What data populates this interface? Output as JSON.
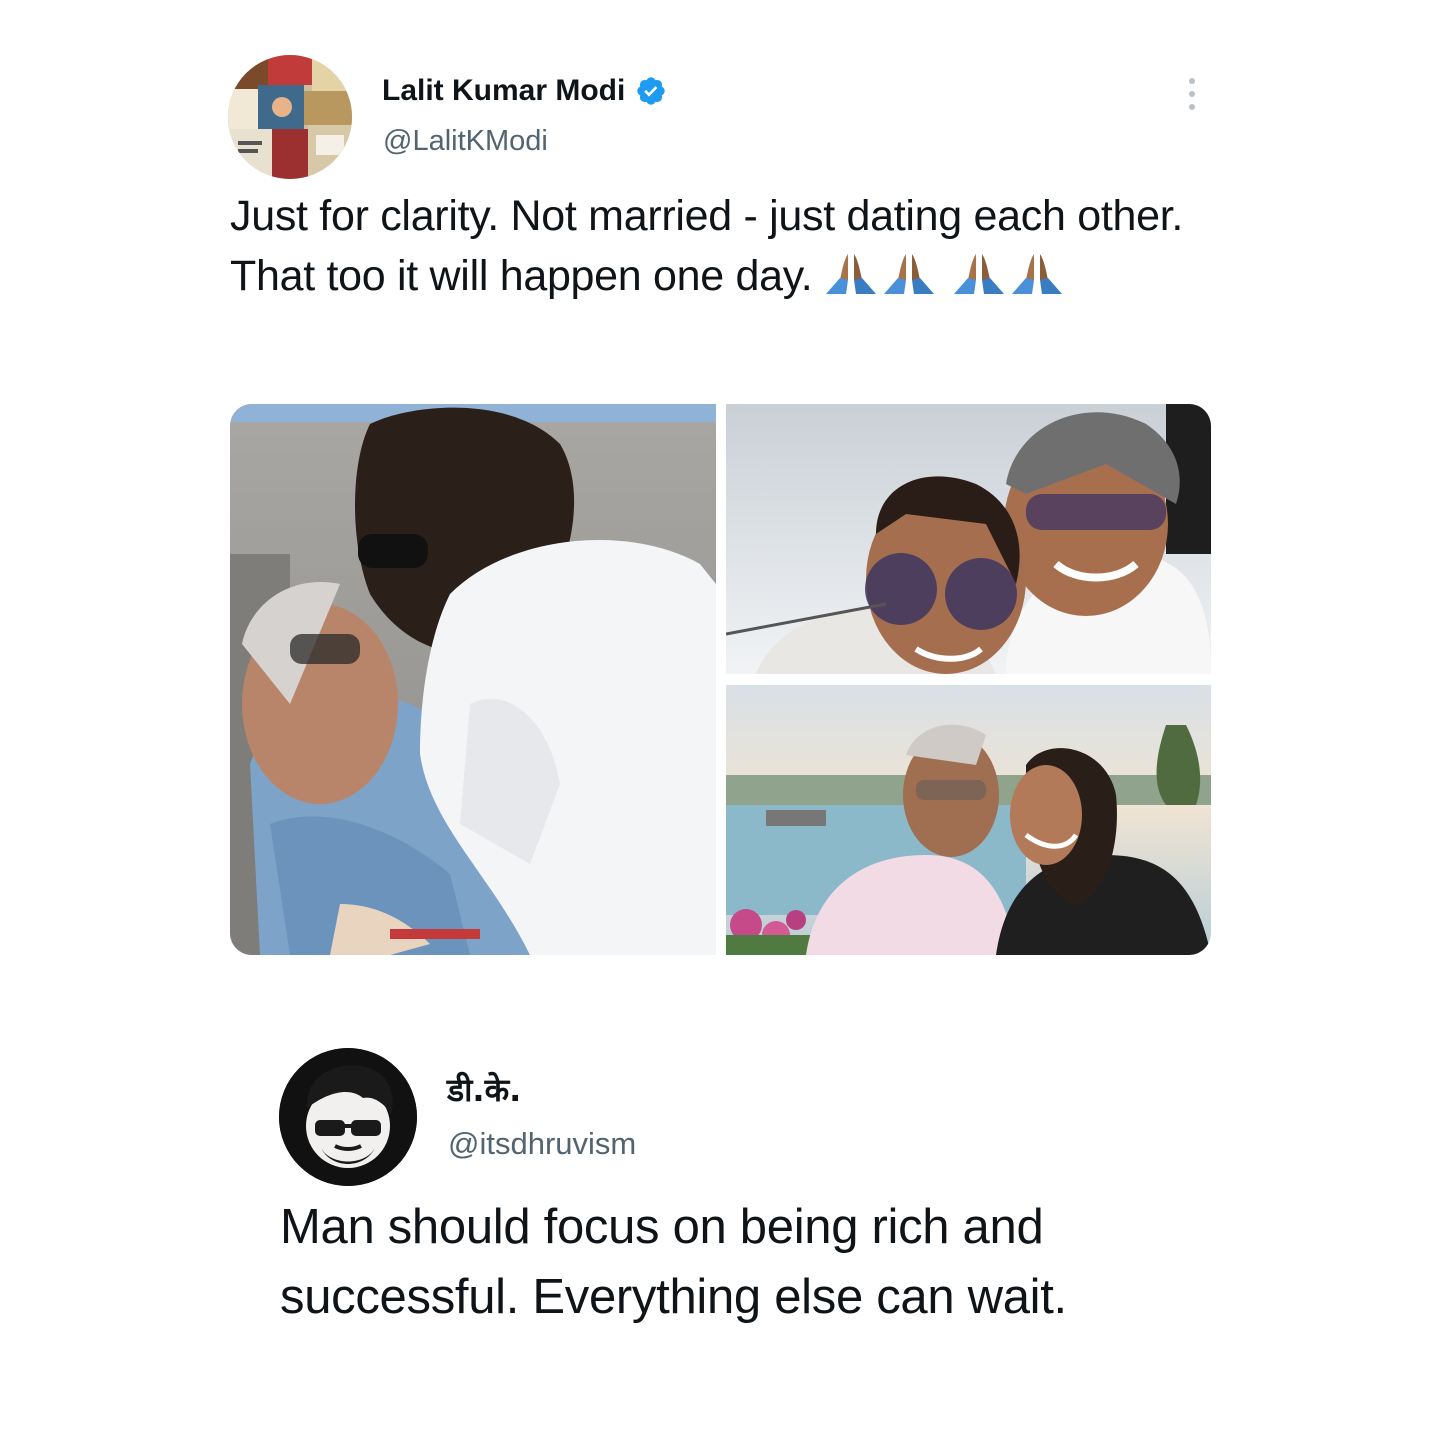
{
  "tweet1": {
    "display_name": "Lalit Kumar Modi",
    "handle": "@LalitKModi",
    "verified_icon": "verified-badge-icon",
    "more_icon": "more-options-icon",
    "text": "Just for clarity. Not married - just dating each other. That too it will happen one day.",
    "emoji": "folded-hands-icon",
    "emoji_count": 4,
    "media": [
      {
        "label": "photo-couple-embrace"
      },
      {
        "label": "photo-selfie-sunglasses"
      },
      {
        "label": "photo-waterfront-sunset"
      }
    ]
  },
  "tweet2": {
    "display_name": "डी.के.",
    "handle": "@itsdhruvism",
    "text": "Man should focus on being rich and successful. Everything else can wait."
  },
  "colors": {
    "text": "#0f1419",
    "secondary": "#536471",
    "verified": "#1d9bf0",
    "background": "#ffffff"
  }
}
